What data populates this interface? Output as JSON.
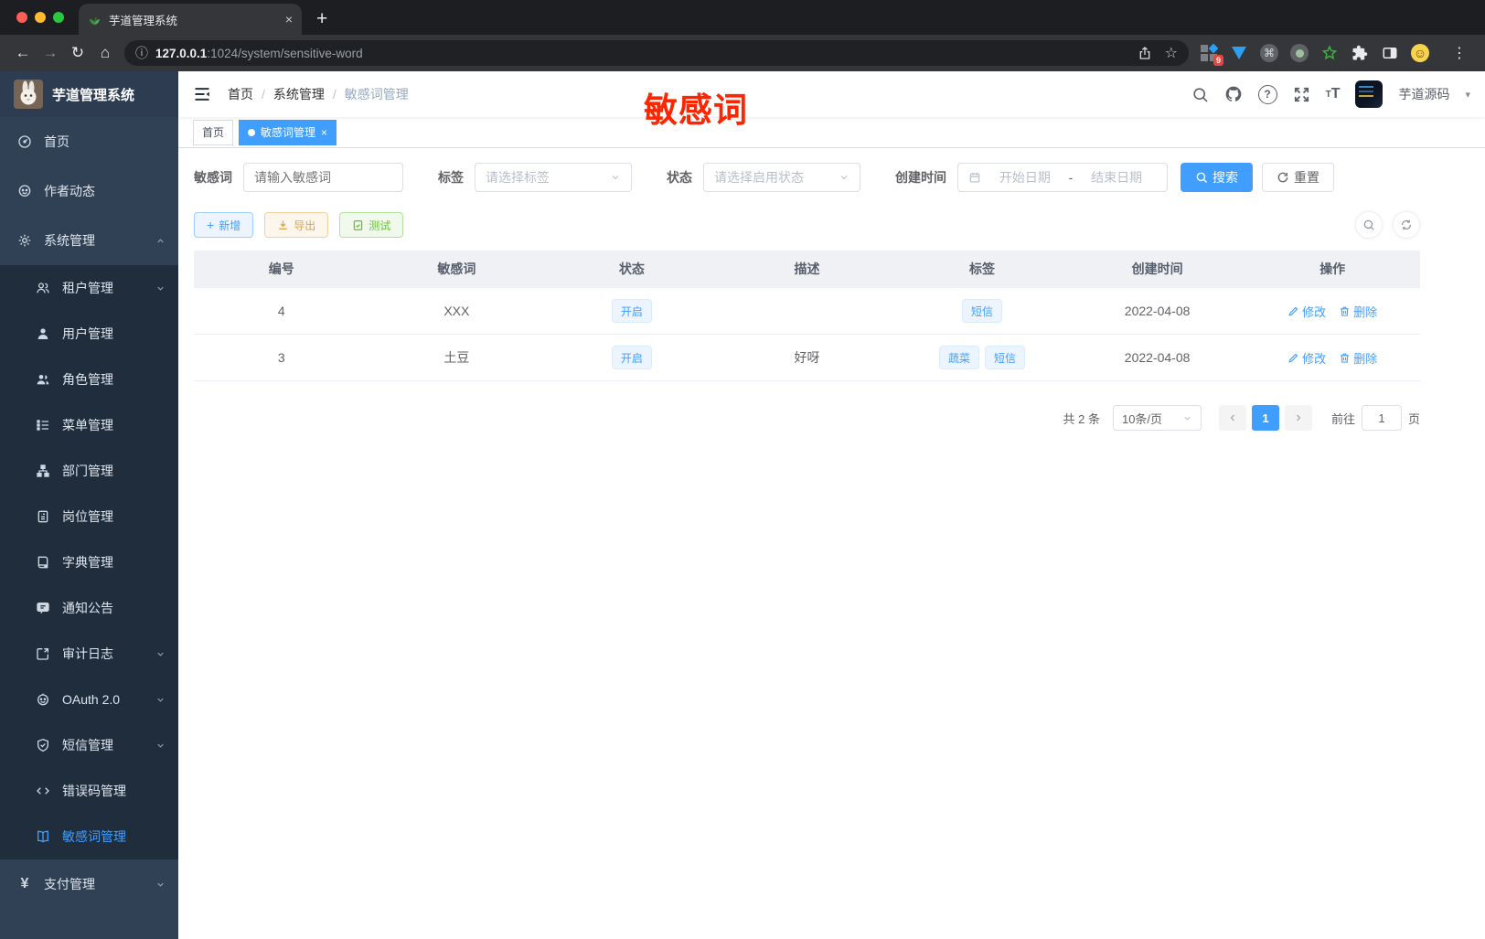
{
  "colors": {
    "accent": "#409eff",
    "warning": "#e6a23c",
    "success": "#67c23a",
    "annotation": "#fe2500",
    "sidebar_bg": "#304156",
    "submenu_bg": "#1f2d3d"
  },
  "browser": {
    "tab_title": "芋道管理系统",
    "url_host": "127.0.0.1",
    "url_rest": ":1024/system/sensitive-word",
    "extension_badge": "9"
  },
  "glyphs": {
    "back": "←",
    "forward": "→",
    "reload": "↻",
    "home": "⌂",
    "info": "ⓘ",
    "star": "☆",
    "plus": "＋",
    "close": "×",
    "kebab": "⋮",
    "command": "⌘",
    "caret": "▾",
    "question": "?",
    "t_small": "T",
    "t_large": "T",
    "smiley": "☺",
    "yen": "¥",
    "code": "</>",
    "prev": "‹",
    "next": "›",
    "btn_plus": "+"
  },
  "sidebar": {
    "title": "芋道管理系统",
    "items": [
      {
        "label": "首页"
      },
      {
        "label": "作者动态"
      },
      {
        "label": "系统管理"
      },
      {
        "label": "租户管理"
      },
      {
        "label": "用户管理"
      },
      {
        "label": "角色管理"
      },
      {
        "label": "菜单管理"
      },
      {
        "label": "部门管理"
      },
      {
        "label": "岗位管理"
      },
      {
        "label": "字典管理"
      },
      {
        "label": "通知公告"
      },
      {
        "label": "审计日志"
      },
      {
        "label": "OAuth 2.0"
      },
      {
        "label": "短信管理"
      },
      {
        "label": "错误码管理"
      },
      {
        "label": "敏感词管理"
      },
      {
        "label": "支付管理"
      }
    ]
  },
  "header": {
    "breadcrumb": [
      "首页",
      "系统管理",
      "敏感词管理"
    ],
    "separator": "/",
    "username": "芋道源码",
    "annotation": "敏感词"
  },
  "tags": [
    {
      "label": "首页"
    },
    {
      "label": "敏感词管理"
    }
  ],
  "filters": {
    "keyword_label": "敏感词",
    "keyword_placeholder": "请输入敏感词",
    "tag_label": "标签",
    "tag_placeholder": "请选择标签",
    "status_label": "状态",
    "status_placeholder": "请选择启用状态",
    "date_label": "创建时间",
    "date_start": "开始日期",
    "date_separator": "-",
    "date_end": "结束日期",
    "search_label": "搜索",
    "reset_label": "重置"
  },
  "toolbar": {
    "add": "新增",
    "export": "导出",
    "test": "测试"
  },
  "table": {
    "headers": [
      "编号",
      "敏感词",
      "状态",
      "描述",
      "标签",
      "创建时间",
      "操作"
    ],
    "rows": [
      {
        "id": "4",
        "word": "XXX",
        "status": "开启",
        "desc": "",
        "tags": [
          "短信"
        ],
        "created": "2022-04-08"
      },
      {
        "id": "3",
        "word": "土豆",
        "status": "开启",
        "desc": "好呀",
        "tags": [
          "蔬菜",
          "短信"
        ],
        "created": "2022-04-08"
      }
    ],
    "edit_label": "修改",
    "delete_label": "删除"
  },
  "pagination": {
    "total": "共 2 条",
    "page_size": "10条/页",
    "current": "1",
    "goto_prefix": "前往",
    "goto_value": "1",
    "goto_suffix": "页"
  }
}
